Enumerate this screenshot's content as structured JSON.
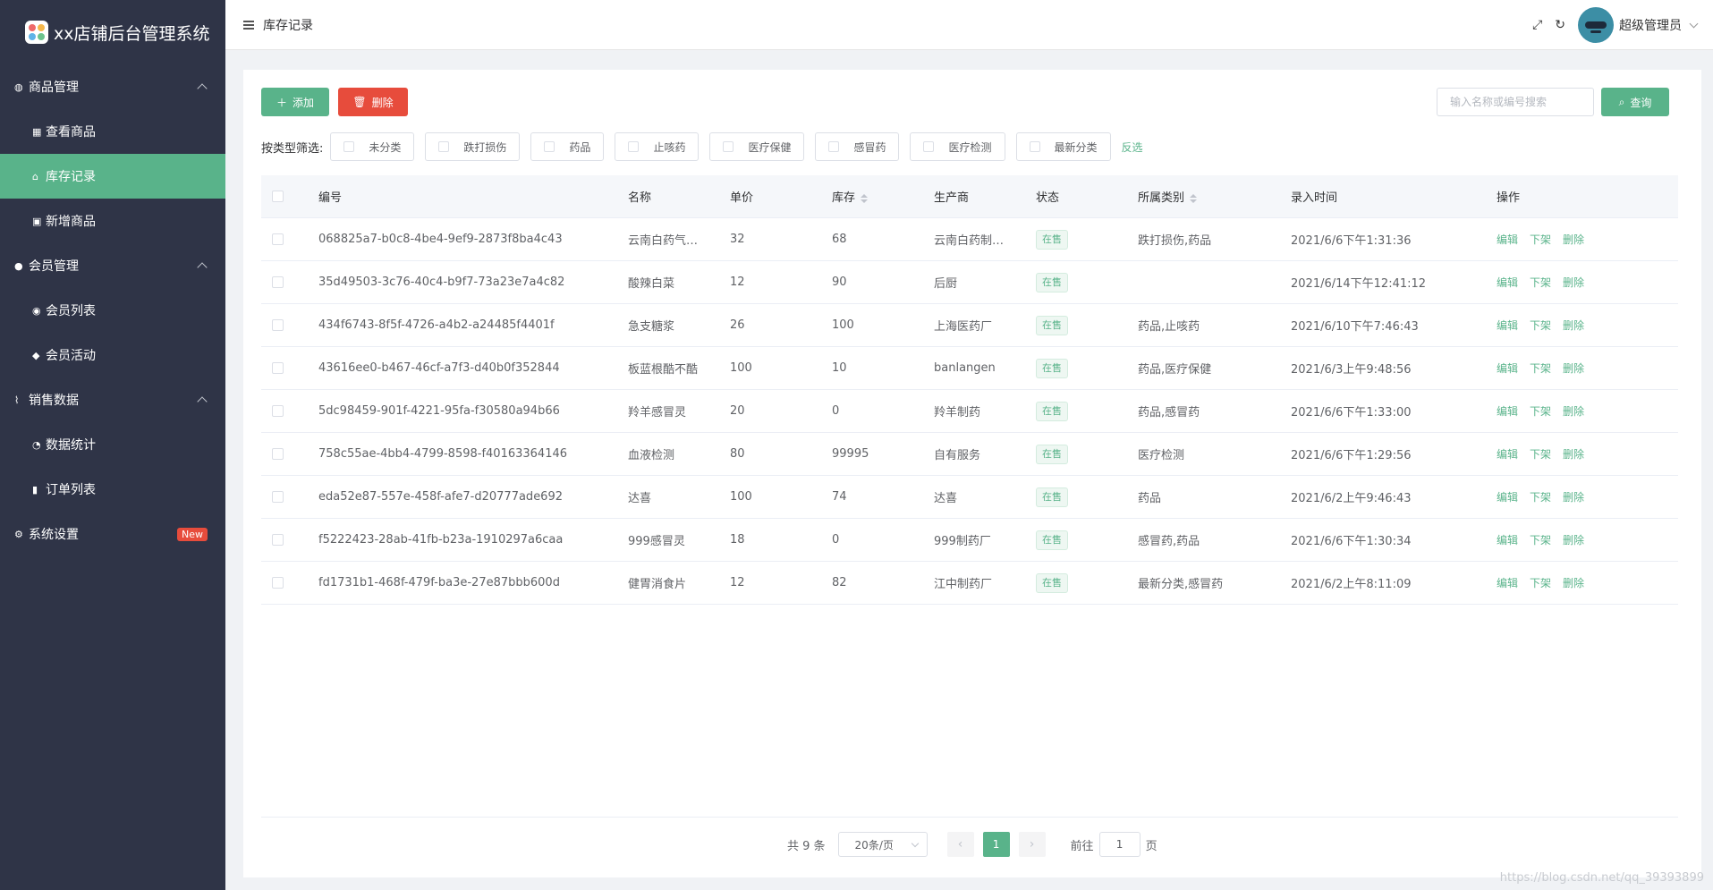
{
  "app": {
    "title": "xx店铺后台管理系统",
    "colors": {
      "primary": "#59b38a",
      "danger": "#e74c3c",
      "sidebar": "#2f3447"
    }
  },
  "sidebar": {
    "groups": [
      {
        "label": "商品管理",
        "icon": "palette-icon",
        "items": [
          {
            "label": "查看商品",
            "icon": "grid-icon"
          },
          {
            "label": "库存记录",
            "icon": "warehouse-icon",
            "active": true
          },
          {
            "label": "新增商品",
            "icon": "folder-plus-icon"
          }
        ]
      },
      {
        "label": "会员管理",
        "icon": "user-check-icon",
        "items": [
          {
            "label": "会员列表",
            "icon": "users-icon"
          },
          {
            "label": "会员活动",
            "icon": "user-secret-icon"
          }
        ]
      },
      {
        "label": "销售数据",
        "icon": "line-chart-icon",
        "items": [
          {
            "label": "数据统计",
            "icon": "pie-chart-icon"
          },
          {
            "label": "订单列表",
            "icon": "mobile-icon"
          }
        ]
      }
    ],
    "settings": {
      "label": "系统设置",
      "icon": "gear-icon",
      "badge": "New"
    }
  },
  "header": {
    "breadcrumb": "库存记录",
    "user": "超级管理员"
  },
  "toolbar": {
    "add_label": "添加",
    "delete_label": "删除",
    "search_placeholder": "输入名称或编号搜索",
    "query_label": "查询"
  },
  "filter": {
    "label": "按类型筛选:",
    "options": [
      "未分类",
      "跌打损伤",
      "药品",
      "止咳药",
      "医疗保健",
      "感冒药",
      "医疗检测",
      "最新分类"
    ],
    "invert_label": "反选"
  },
  "table": {
    "headers": [
      "编号",
      "名称",
      "单价",
      "库存",
      "生产商",
      "状态",
      "所属类别",
      "录入时间",
      "操作"
    ],
    "actions": [
      "编辑",
      "下架",
      "删除"
    ],
    "rows": [
      {
        "id": "068825a7-b0c8-4be4-9ef9-2873f8ba4c43",
        "name": "云南白药气…",
        "price": "32",
        "stock": "68",
        "maker": "云南白药制…",
        "status": "在售",
        "category": "跌打损伤,药品",
        "time": "2021/6/6下午1:31:36"
      },
      {
        "id": "35d49503-3c76-40c4-b9f7-73a23e7a4c82",
        "name": "酸辣白菜",
        "price": "12",
        "stock": "90",
        "maker": "后厨",
        "status": "在售",
        "category": "",
        "time": "2021/6/14下午12:41:12"
      },
      {
        "id": "434f6743-8f5f-4726-a4b2-a24485f4401f",
        "name": "急支糖浆",
        "price": "26",
        "stock": "100",
        "maker": "上海医药厂",
        "status": "在售",
        "category": "药品,止咳药",
        "time": "2021/6/10下午7:46:43"
      },
      {
        "id": "43616ee0-b467-46cf-a7f3-d40b0f352844",
        "name": "板蓝根酷不酷",
        "price": "100",
        "stock": "10",
        "maker": "banlangen",
        "status": "在售",
        "category": "药品,医疗保健",
        "time": "2021/6/3上午9:48:56"
      },
      {
        "id": "5dc98459-901f-4221-95fa-f30580a94b66",
        "name": "羚羊感冒灵",
        "price": "20",
        "stock": "0",
        "maker": "羚羊制药",
        "status": "在售",
        "category": "药品,感冒药",
        "time": "2021/6/6下午1:33:00"
      },
      {
        "id": "758c55ae-4bb4-4799-8598-f40163364146",
        "name": "血液检测",
        "price": "80",
        "stock": "99995",
        "maker": "自有服务",
        "status": "在售",
        "category": "医疗检测",
        "time": "2021/6/6下午1:29:56"
      },
      {
        "id": "eda52e87-557e-458f-afe7-d20777ade692",
        "name": "达喜",
        "price": "100",
        "stock": "74",
        "maker": "达喜",
        "status": "在售",
        "category": "药品",
        "time": "2021/6/2上午9:46:43"
      },
      {
        "id": "f5222423-28ab-41fb-b23a-1910297a6caa",
        "name": "999感冒灵",
        "price": "18",
        "stock": "0",
        "maker": "999制药厂",
        "status": "在售",
        "category": "感冒药,药品",
        "time": "2021/6/6下午1:30:34"
      },
      {
        "id": "fd1731b1-468f-479f-ba3e-27e87bbb600d",
        "name": "健胃消食片",
        "price": "12",
        "stock": "82",
        "maker": "江中制药厂",
        "status": "在售",
        "category": "最新分类,感冒药",
        "time": "2021/6/2上午8:11:09"
      }
    ]
  },
  "pagination": {
    "total_label": "共 9 条",
    "page_size": "20条/页",
    "current_page": "1",
    "goto_label": "前往",
    "goto_value": "1",
    "page_suffix": "页"
  },
  "watermark": "https://blog.csdn.net/qq_39393899"
}
